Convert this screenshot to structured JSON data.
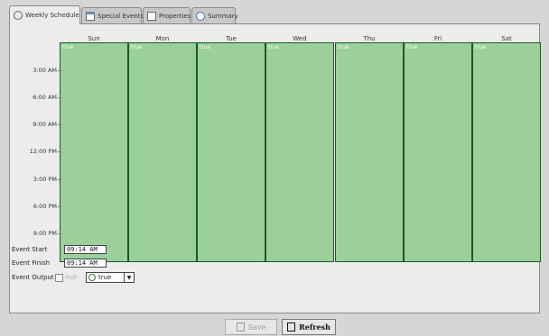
{
  "tabs": [
    {
      "label": "Weekly Schedule",
      "icon": "schedule-icon",
      "active": true
    },
    {
      "label": "Special Events",
      "icon": "calendar-icon",
      "active": false
    },
    {
      "label": "Properties",
      "icon": "properties-icon",
      "active": false
    },
    {
      "label": "Summary",
      "icon": "clock-icon",
      "active": false
    }
  ],
  "days": [
    "Sun",
    "Mon",
    "Tue",
    "Wed",
    "Thu",
    "Fri",
    "Sat"
  ],
  "block_label": "true",
  "block_color": "#9cd09b",
  "time_labels": [
    "3:00 AM",
    "6:00 AM",
    "9:00 AM",
    "12:00 PM",
    "3:00 PM",
    "6:00 PM",
    "9:00 PM"
  ],
  "event": {
    "start_label": "Event Start",
    "start_value": "09:14 AM",
    "finish_label": "Event Finish",
    "finish_value": "09:14 AM",
    "output_label": "Event Output",
    "null_label": "null",
    "output_value": "true"
  },
  "buttons": {
    "save": "Save",
    "refresh": "Refresh"
  }
}
